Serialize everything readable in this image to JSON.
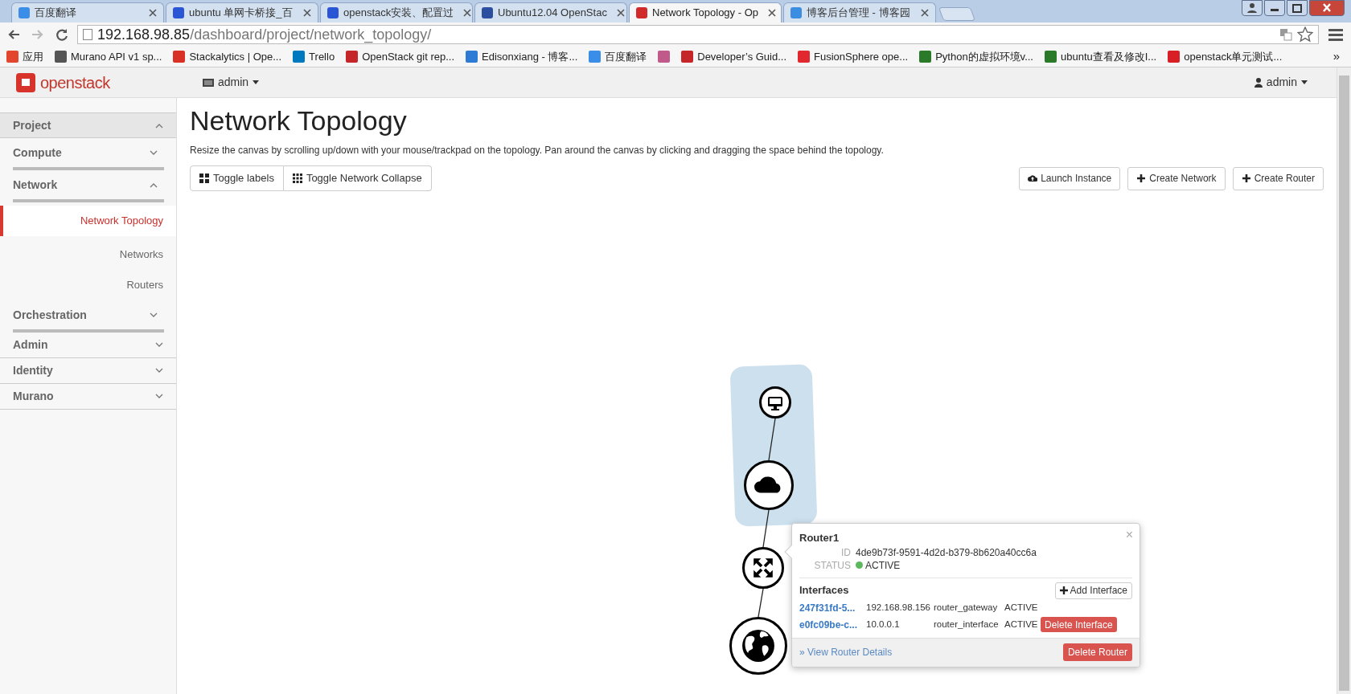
{
  "browser": {
    "tabs": [
      {
        "title": "百度翻译",
        "selected": false,
        "color": "#3b8ee8"
      },
      {
        "title": "ubuntu 单网卡桥接_百",
        "selected": false,
        "color": "#2a55d4"
      },
      {
        "title": "openstack安装、配置过",
        "selected": false,
        "color": "#2a55d4"
      },
      {
        "title": "Ubuntu12.04 OpenStac",
        "selected": false,
        "color": "#2b4f9e"
      },
      {
        "title": "Network Topology - Op",
        "selected": true,
        "color": "#d02a2a"
      },
      {
        "title": "博客后台管理 - 博客园",
        "selected": false,
        "color": "#3a8de0"
      }
    ],
    "address": {
      "host": "192.168.98.85",
      "path": "/dashboard/project/network_topology/"
    },
    "bookmarks": [
      {
        "label": "应用",
        "color": "#e2462f"
      },
      {
        "label": "Murano API v1 sp...",
        "color": "#555555"
      },
      {
        "label": "Stackalytics | Ope...",
        "color": "#d93025"
      },
      {
        "label": "Trello",
        "color": "#0079bf"
      },
      {
        "label": "OpenStack git rep...",
        "color": "#c4262a"
      },
      {
        "label": "Edisonxiang - 博客...",
        "color": "#2e7bd6"
      },
      {
        "label": "百度翻译",
        "color": "#3b8ee8"
      },
      {
        "color": "#c05a8a"
      },
      {
        "label": "Developer’s Guid...",
        "color": "#c4262a"
      },
      {
        "label": "FusionSphere ope...",
        "color": "#e0282e"
      },
      {
        "label": "Python的虚拟环境v...",
        "color": "#2a7a2a"
      },
      {
        "label": "ubuntu查看及修改I...",
        "color": "#2a7a2a"
      },
      {
        "label": "openstack单元测试...",
        "color": "#d81f26"
      }
    ],
    "more": "»"
  },
  "header": {
    "logo": "openstack",
    "project": "admin",
    "user": "admin"
  },
  "sidebar": [
    {
      "label": "Project",
      "expanded": true
    },
    {
      "label": "Compute",
      "expanded": false
    },
    {
      "label": "Network",
      "expanded": true,
      "children": [
        {
          "label": "Network Topology",
          "selected": true
        },
        {
          "label": "Networks",
          "selected": false
        },
        {
          "label": "Routers",
          "selected": false
        }
      ]
    },
    {
      "label": "Orchestration",
      "expanded": false
    },
    {
      "label": "Admin",
      "expanded": false
    },
    {
      "label": "Identity",
      "expanded": false
    },
    {
      "label": "Murano",
      "expanded": false
    }
  ],
  "page": {
    "title": "Network Topology",
    "description": "Resize the canvas by scrolling up/down with your mouse/trackpad on the topology. Pan around the canvas by clicking and dragging the space behind the topology.",
    "toggles": [
      "Toggle labels",
      "Toggle Network Collapse"
    ],
    "actions": [
      "Launch Instance",
      "Create Network",
      "Create Router"
    ]
  },
  "topology": {
    "nodes": [
      {
        "kind": "instance"
      },
      {
        "kind": "network"
      },
      {
        "kind": "router"
      },
      {
        "kind": "external"
      }
    ]
  },
  "popup": {
    "title": "Router1",
    "close": "×",
    "fields": [
      {
        "label": "ID",
        "value": "4de9b73f-9591-4d2d-b379-8b620a40cc6a"
      },
      {
        "label": "STATUS",
        "value": "ACTIVE",
        "color": "#5cb85c"
      }
    ],
    "interfaces_heading": "Interfaces",
    "add_button": "Add Interface",
    "interfaces": [
      {
        "id": "247f31fd-5...",
        "ip": "192.168.98.156",
        "type": "router_gateway",
        "status": "ACTIVE"
      },
      {
        "id": "e0fc09be-c...",
        "ip": "10.0.0.1",
        "type": "router_interface",
        "status": "ACTIVE",
        "action": "Delete Interface"
      }
    ],
    "details_link": "» View Router Details",
    "delete_button": "Delete Router"
  }
}
